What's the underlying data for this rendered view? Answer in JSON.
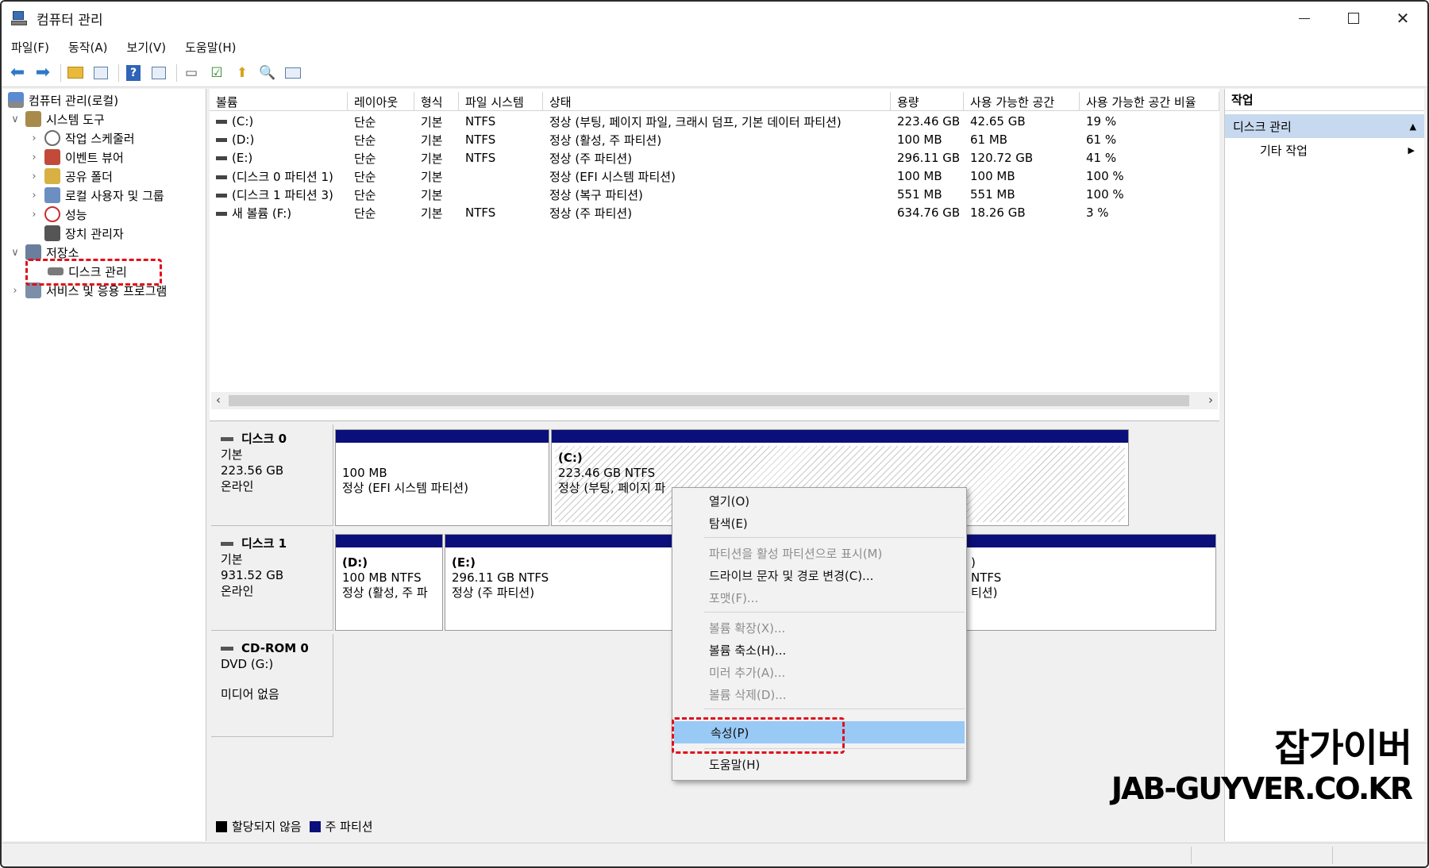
{
  "window": {
    "title": "컴퓨터 관리"
  },
  "menu": [
    "파일(F)",
    "동작(A)",
    "보기(V)",
    "도움말(H)"
  ],
  "tree": {
    "root": "컴퓨터 관리(로컬)",
    "system_tools": "시스템 도구",
    "task_scheduler": "작업 스케줄러",
    "event_viewer": "이벤트 뷰어",
    "shared_folders": "공유 폴더",
    "local_users": "로컬 사용자 및 그룹",
    "performance": "성능",
    "device_manager": "장치 관리자",
    "storage": "저장소",
    "disk_management": "디스크 관리",
    "services_apps": "서비스 및 응용 프로그램"
  },
  "volume_table": {
    "columns": [
      "볼륨",
      "레이아웃",
      "형식",
      "파일 시스템",
      "상태",
      "용량",
      "사용 가능한 공간",
      "사용 가능한 공간 비율"
    ],
    "rows": [
      [
        "(C:)",
        "단순",
        "기본",
        "NTFS",
        "정상 (부팅, 페이지 파일, 크래시 덤프, 기본 데이터 파티션)",
        "223.46 GB",
        "42.65 GB",
        "19 %"
      ],
      [
        "(D:)",
        "단순",
        "기본",
        "NTFS",
        "정상 (활성, 주 파티션)",
        "100 MB",
        "61 MB",
        "61 %"
      ],
      [
        "(E:)",
        "단순",
        "기본",
        "NTFS",
        "정상 (주 파티션)",
        "296.11 GB",
        "120.72 GB",
        "41 %"
      ],
      [
        "(디스크 0 파티션 1)",
        "단순",
        "기본",
        "",
        "정상 (EFI 시스템 파티션)",
        "100 MB",
        "100 MB",
        "100 %"
      ],
      [
        "(디스크 1 파티션 3)",
        "단순",
        "기본",
        "",
        "정상 (복구 파티션)",
        "551 MB",
        "551 MB",
        "100 %"
      ],
      [
        "새 볼륨 (F:)",
        "단순",
        "기본",
        "NTFS",
        "정상 (주 파티션)",
        "634.76 GB",
        "18.26 GB",
        "3 %"
      ]
    ]
  },
  "disks": {
    "disk0": {
      "name": "디스크 0",
      "type": "기본",
      "size": "223.56 GB",
      "status": "온라인",
      "p1": {
        "l1": "100 MB",
        "l2": "정상 (EFI 시스템 파티션)"
      },
      "p2": {
        "l0": "(C:)",
        "l1": "223.46 GB NTFS",
        "l2": "정상 (부팅, 페이지 파"
      }
    },
    "disk1": {
      "name": "디스크 1",
      "type": "기본",
      "size": "931.52 GB",
      "status": "온라인",
      "p1": {
        "l0": "(D:)",
        "l1": "100 MB NTFS",
        "l2": "정상 (활성, 주 파"
      },
      "p2": {
        "l0": "(E:)",
        "l1": "296.11 GB NTFS",
        "l2": "정상 (주 파티션)"
      },
      "p3": {
        "l0": ")",
        "l1": "NTFS",
        "l2": "티션)"
      }
    },
    "cdrom": {
      "name": "CD-ROM 0",
      "type": "DVD (G:)",
      "status": "미디어 없음"
    }
  },
  "legend": {
    "unallocated": "할당되지 않음",
    "primary": "주 파티션"
  },
  "actions": {
    "header": "작업",
    "section": "디스크 관리",
    "other": "기타 작업"
  },
  "context_menu": {
    "open": "열기(O)",
    "explore": "탐색(E)",
    "mark_active": "파티션을 활성 파티션으로 표시(M)",
    "change_letter": "드라이브 문자 및 경로 변경(C)...",
    "format": "포맷(F)...",
    "extend": "볼륨 확장(X)...",
    "shrink": "볼륨 축소(H)...",
    "add_mirror": "미러 추가(A)...",
    "delete": "볼륨 삭제(D)...",
    "properties": "속성(P)",
    "help": "도움말(H)"
  },
  "watermark": {
    "korean": "잡가이버",
    "english": "JAB-GUYVER.CO.KR"
  },
  "colors": {
    "primary_partition": "#0a0f7a",
    "highlight": "#99c9f5",
    "annotation": "#e0101a"
  }
}
